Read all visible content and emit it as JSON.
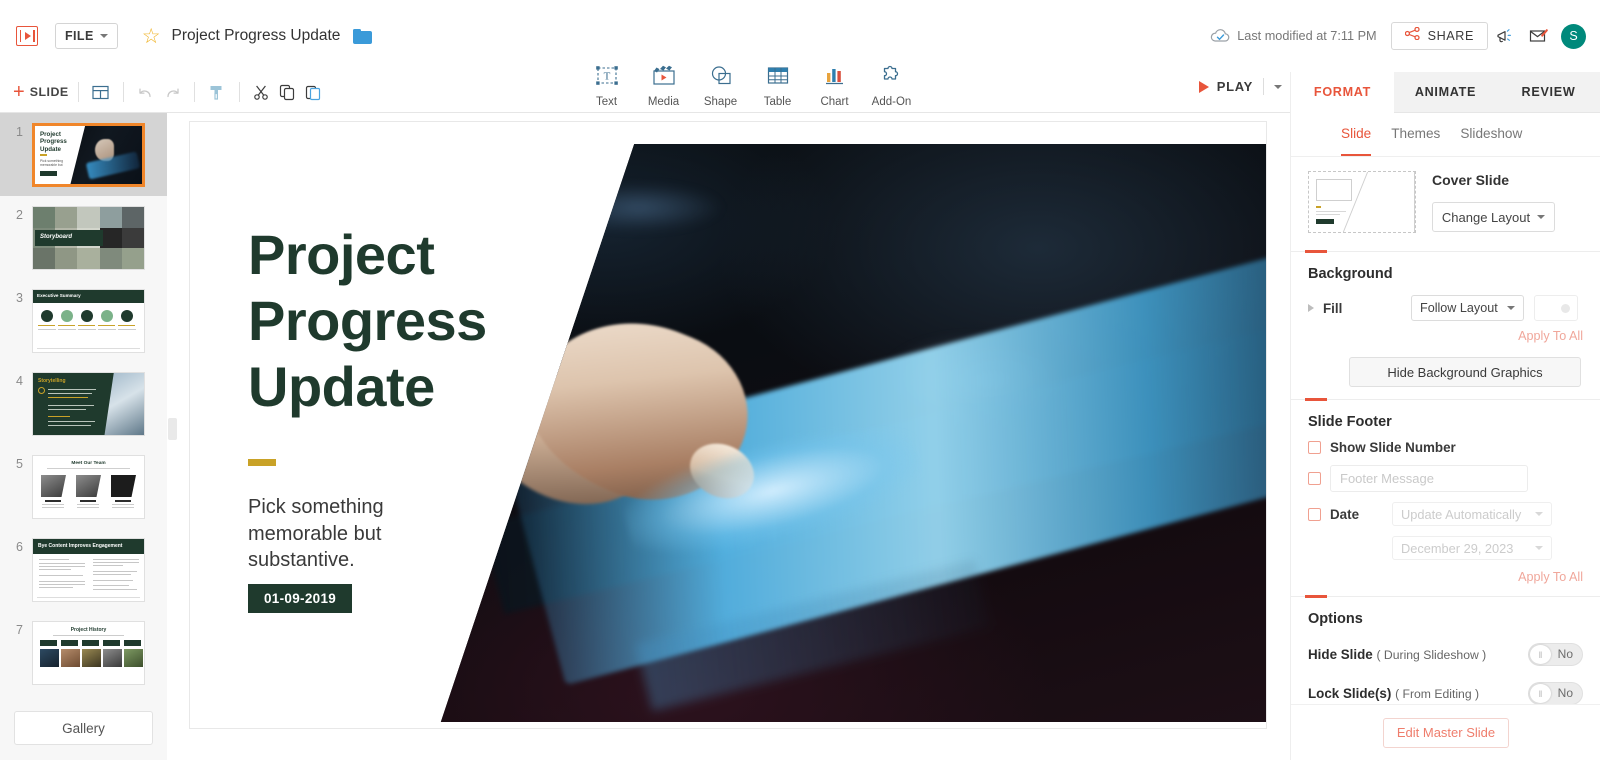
{
  "header": {
    "file_menu": "FILE",
    "doc_title": "Project Progress Update",
    "last_modified": "Last modified at 7:11 PM",
    "share_label": "SHARE",
    "avatar_initial": "S",
    "icons": {
      "logo": "zoho-show-logo-icon",
      "star": "star-icon",
      "folder": "folder-icon",
      "cloud": "cloud-sync-icon",
      "share": "share-nodes-icon",
      "announcement": "megaphone-icon",
      "mail": "compose-mail-icon"
    }
  },
  "toolbar": {
    "add_slide": "SLIDE",
    "icons": [
      "layout-icon",
      "undo-icon",
      "redo-icon",
      "format-painter-icon",
      "cut-icon",
      "copy-icon",
      "paste-icon"
    ],
    "insert_tools": [
      {
        "label": "Text",
        "icon": "text-box-icon"
      },
      {
        "label": "Media",
        "icon": "media-clapper-icon"
      },
      {
        "label": "Shape",
        "icon": "shape-icon"
      },
      {
        "label": "Table",
        "icon": "table-icon"
      },
      {
        "label": "Chart",
        "icon": "bar-chart-icon"
      },
      {
        "label": "Add-On",
        "icon": "puzzle-piece-icon"
      }
    ],
    "play_label": "PLAY"
  },
  "sidebar": {
    "slides": [
      {
        "number": "1",
        "name": "Project Progress Update",
        "active": true
      },
      {
        "number": "2",
        "name": "Storyboard",
        "active": false
      },
      {
        "number": "3",
        "name": "Executive Summary",
        "active": false
      },
      {
        "number": "4",
        "name": "Storytelling",
        "active": false
      },
      {
        "number": "5",
        "name": "Meet Our Team",
        "active": false
      },
      {
        "number": "6",
        "name": "Bye Content Improves Engagement",
        "active": false
      },
      {
        "number": "7",
        "name": "Project History",
        "active": false
      }
    ],
    "gallery_label": "Gallery"
  },
  "slide": {
    "title_line1": "Project",
    "title_line2": "Progress",
    "title_line3": "Update",
    "subtitle": "Pick something memorable but substantive.",
    "date_badge": "01-09-2019",
    "image_alt": "finger-touching-glowing-tablet-photo"
  },
  "right_panel": {
    "tabs": [
      {
        "label": "FORMAT",
        "active": true
      },
      {
        "label": "ANIMATE",
        "active": false
      },
      {
        "label": "REVIEW",
        "active": false
      }
    ],
    "sub_tabs": [
      {
        "label": "Slide",
        "active": true
      },
      {
        "label": "Themes",
        "active": false
      },
      {
        "label": "Slideshow",
        "active": false
      }
    ],
    "layout": {
      "name": "Cover Slide",
      "change_button": "Change Layout"
    },
    "background": {
      "title": "Background",
      "fill_label": "Fill",
      "fill_value": "Follow Layout",
      "apply_to_all": "Apply To All",
      "hide_graphics": "Hide Background Graphics"
    },
    "slide_footer": {
      "title": "Slide Footer",
      "show_slide_number": "Show Slide Number",
      "footer_message_placeholder": "Footer Message",
      "date_label": "Date",
      "date_mode": "Update Automatically",
      "date_value": "December 29, 2023",
      "apply_to_all": "Apply To All"
    },
    "options": {
      "title": "Options",
      "hide_slide_label": "Hide Slide",
      "hide_slide_note": "( During Slideshow )",
      "hide_slide_value": "No",
      "lock_slide_label": "Lock Slide(s)",
      "lock_slide_note": "( From Editing )",
      "lock_slide_value": "No"
    },
    "edit_master": "Edit Master Slide"
  },
  "colors": {
    "accent_red": "#e8553b",
    "brand_green": "#1f3a2d",
    "gold": "#c9a227",
    "avatar_teal": "#00897b",
    "active_thumb_border": "#f0862a"
  }
}
